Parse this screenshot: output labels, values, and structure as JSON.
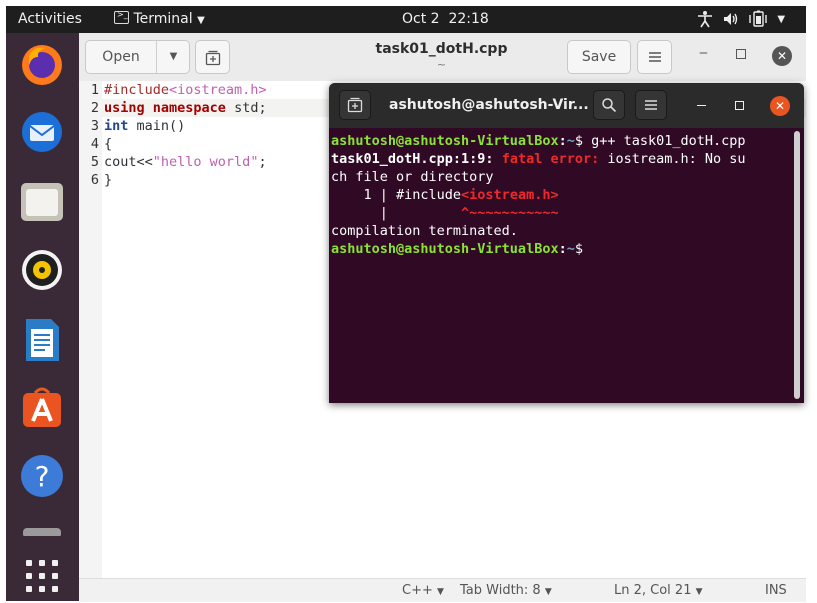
{
  "topbar": {
    "activities": "Activities",
    "app_name": "Terminal",
    "date": "Oct 2",
    "time": "22:18"
  },
  "dock": {
    "items": [
      "firefox-icon",
      "thunderbird-icon",
      "files-icon",
      "rhythmbox-icon",
      "libreoffice-writer-icon",
      "ubuntu-software-icon",
      "help-icon",
      "show-applications-icon"
    ]
  },
  "editor": {
    "open_label": "Open",
    "title": "task01_dotH.cpp",
    "subtitle": "~",
    "save_label": "Save",
    "line_numbers": [
      "1",
      "2",
      "3",
      "4",
      "5",
      "6"
    ],
    "lines": [
      {
        "a": "#include",
        "b": "<iostream.h>"
      },
      {
        "a": "using",
        "b": " ",
        "c": "namespace",
        "d": " std;"
      },
      {
        "a": "int",
        "b": " main()"
      },
      {
        "a": "{"
      },
      {
        "a": "cout<<",
        "b": "\"hello world\"",
        "c": ";"
      },
      {
        "a": "}"
      }
    ],
    "status": {
      "language": "C++",
      "tab_width": "Tab Width: 8",
      "position": "Ln 2, Col 21",
      "mode": "INS"
    }
  },
  "terminal": {
    "title": "ashutosh@ashutosh-Vir...",
    "prompt_user": "ashutosh@ashutosh-VirtualBox",
    "prompt_sep": ":",
    "prompt_dir": "~",
    "prompt_sym": "$",
    "command": " g++ task01_dotH.cpp",
    "err_loc": "task01_dotH.cpp:1:9:",
    "err_label": "fatal error:",
    "err_msg": " iostream.h: No su",
    "err_msg2": "ch file or directory",
    "src_line_prefix": "    1 | #include",
    "src_line_hl": "<iostream.h>",
    "caret_prefix": "      |         ",
    "caret": "^~~~~~~~~~~~",
    "terminated": "compilation terminated."
  }
}
